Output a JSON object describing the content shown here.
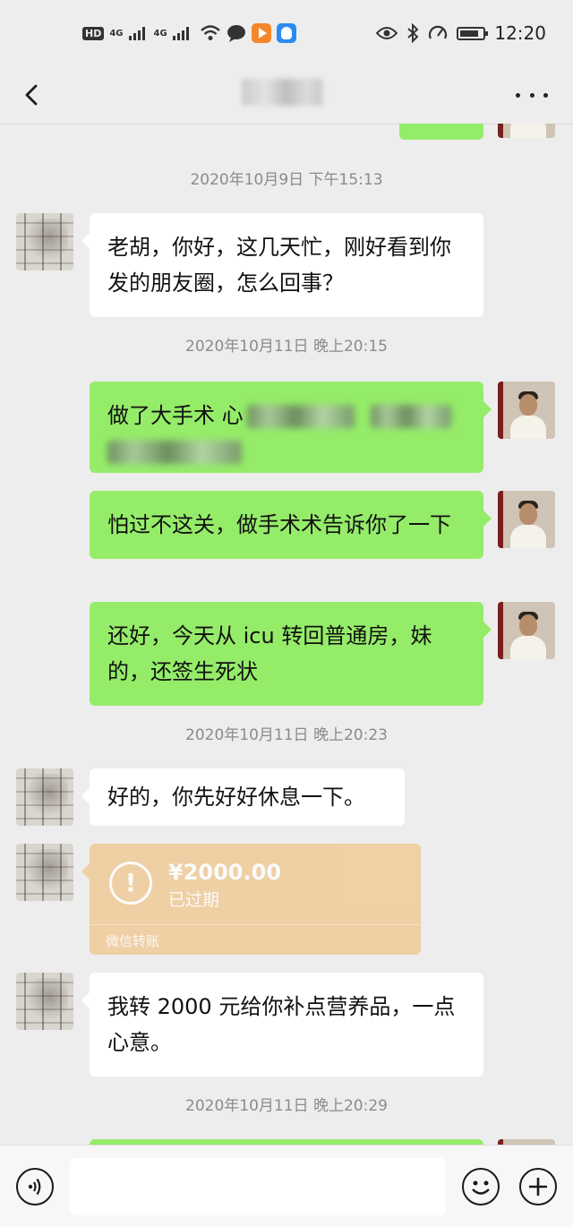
{
  "status_bar": {
    "left_indicators": [
      "HD",
      "4G",
      "4G"
    ],
    "time": "12:20"
  },
  "nav": {
    "back_icon": "chevron-left-icon",
    "more_icon": "ellipsis-icon"
  },
  "messages": {
    "ts1": "2020年10月9日 下午15:13",
    "m1": "老胡，你好，这几天忙，刚好看到你发的朋友圈，怎么回事？",
    "ts2": "2020年10月11日 晚上20:15",
    "m2_visible": "做了大手术 心",
    "m3": "怕过不这关，做手术术告诉你了一下",
    "m4": "还好，今天从 icu 转回普通房，妹的，还签生死状",
    "ts3": "2020年10月11日 晚上20:23",
    "m5": "好的，你先好好休息一下。",
    "transfer": {
      "amount": "¥2000.00",
      "status": "已过期",
      "label": "微信转账",
      "icon": "exclamation-circle-icon"
    },
    "m6": "我转 2000 元给你补点营养品，一点心意。",
    "ts4": "2020年10月11日 晚上20:29"
  },
  "input_bar": {
    "voice_icon": "voice-icon",
    "emoji_icon": "emoji-icon",
    "plus_icon": "plus-icon"
  },
  "colors": {
    "background": "#ededed",
    "self_bubble": "#95ec69",
    "other_bubble": "#ffffff",
    "transfer_card": "#f0c995"
  }
}
